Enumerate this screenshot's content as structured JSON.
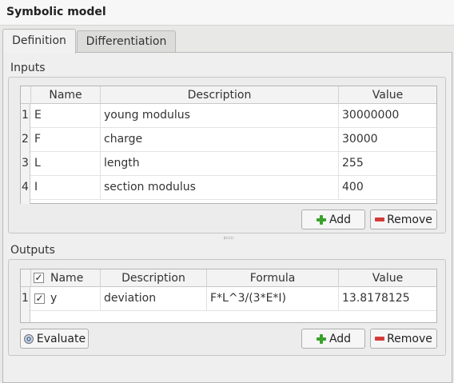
{
  "window": {
    "title": "Symbolic model"
  },
  "tabs": [
    {
      "label": "Definition",
      "active": true
    },
    {
      "label": "Differentiation",
      "active": false
    }
  ],
  "inputs": {
    "title": "Inputs",
    "columns": [
      "Name",
      "Description",
      "Value"
    ],
    "rows": [
      {
        "num": "1",
        "name": "E",
        "description": "young modulus",
        "value": "30000000"
      },
      {
        "num": "2",
        "name": "F",
        "description": "charge",
        "value": "30000"
      },
      {
        "num": "3",
        "name": "L",
        "description": "length",
        "value": "255"
      },
      {
        "num": "4",
        "name": "I",
        "description": "section modulus",
        "value": "400"
      }
    ],
    "add_label": "Add",
    "remove_label": "Remove"
  },
  "outputs": {
    "title": "Outputs",
    "header_check": "✓",
    "columns": [
      "Name",
      "Description",
      "Formula",
      "Value"
    ],
    "rows": [
      {
        "num": "1",
        "check": "✓",
        "name": "y",
        "description": "deviation",
        "formula": "F*L^3/(3*E*I)",
        "value": "13.8178125"
      }
    ],
    "evaluate_label": "Evaluate",
    "add_label": "Add",
    "remove_label": "Remove"
  },
  "icons": {
    "add": "plus-icon",
    "remove": "minus-icon",
    "evaluate": "gear-icon"
  },
  "colors": {
    "add": "#3aa12c",
    "remove": "#d43a3a"
  }
}
